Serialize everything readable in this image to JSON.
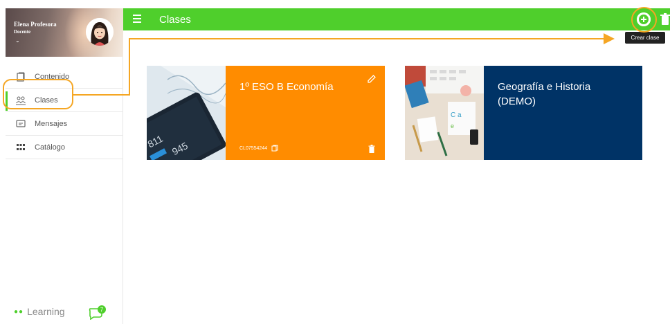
{
  "profile": {
    "name": "Elena Profesora",
    "role": "Docente"
  },
  "sidebar": {
    "items": [
      {
        "label": "Contenido",
        "icon": "book-icon"
      },
      {
        "label": "Clases",
        "icon": "users-icon",
        "active": true
      },
      {
        "label": "Mensajes",
        "icon": "message-icon"
      },
      {
        "label": "Catálogo",
        "icon": "grid-icon"
      }
    ],
    "brand": "Learning",
    "chat_badge_count": "7"
  },
  "topbar": {
    "title": "Clases",
    "add_tooltip": "Crear clase"
  },
  "cards": [
    {
      "title": "1º ESO B Economía",
      "code": "CL07554244",
      "color": "#ff8c00",
      "image": "finance-tablet-image"
    },
    {
      "title": "Geografía e Historia (DEMO)",
      "color": "#003366",
      "image": "desk-supplies-image"
    }
  ],
  "colors": {
    "primary": "#4fcf2c",
    "annotation": "#f5a623",
    "card_orange": "#ff8c00",
    "card_navy": "#003366"
  }
}
